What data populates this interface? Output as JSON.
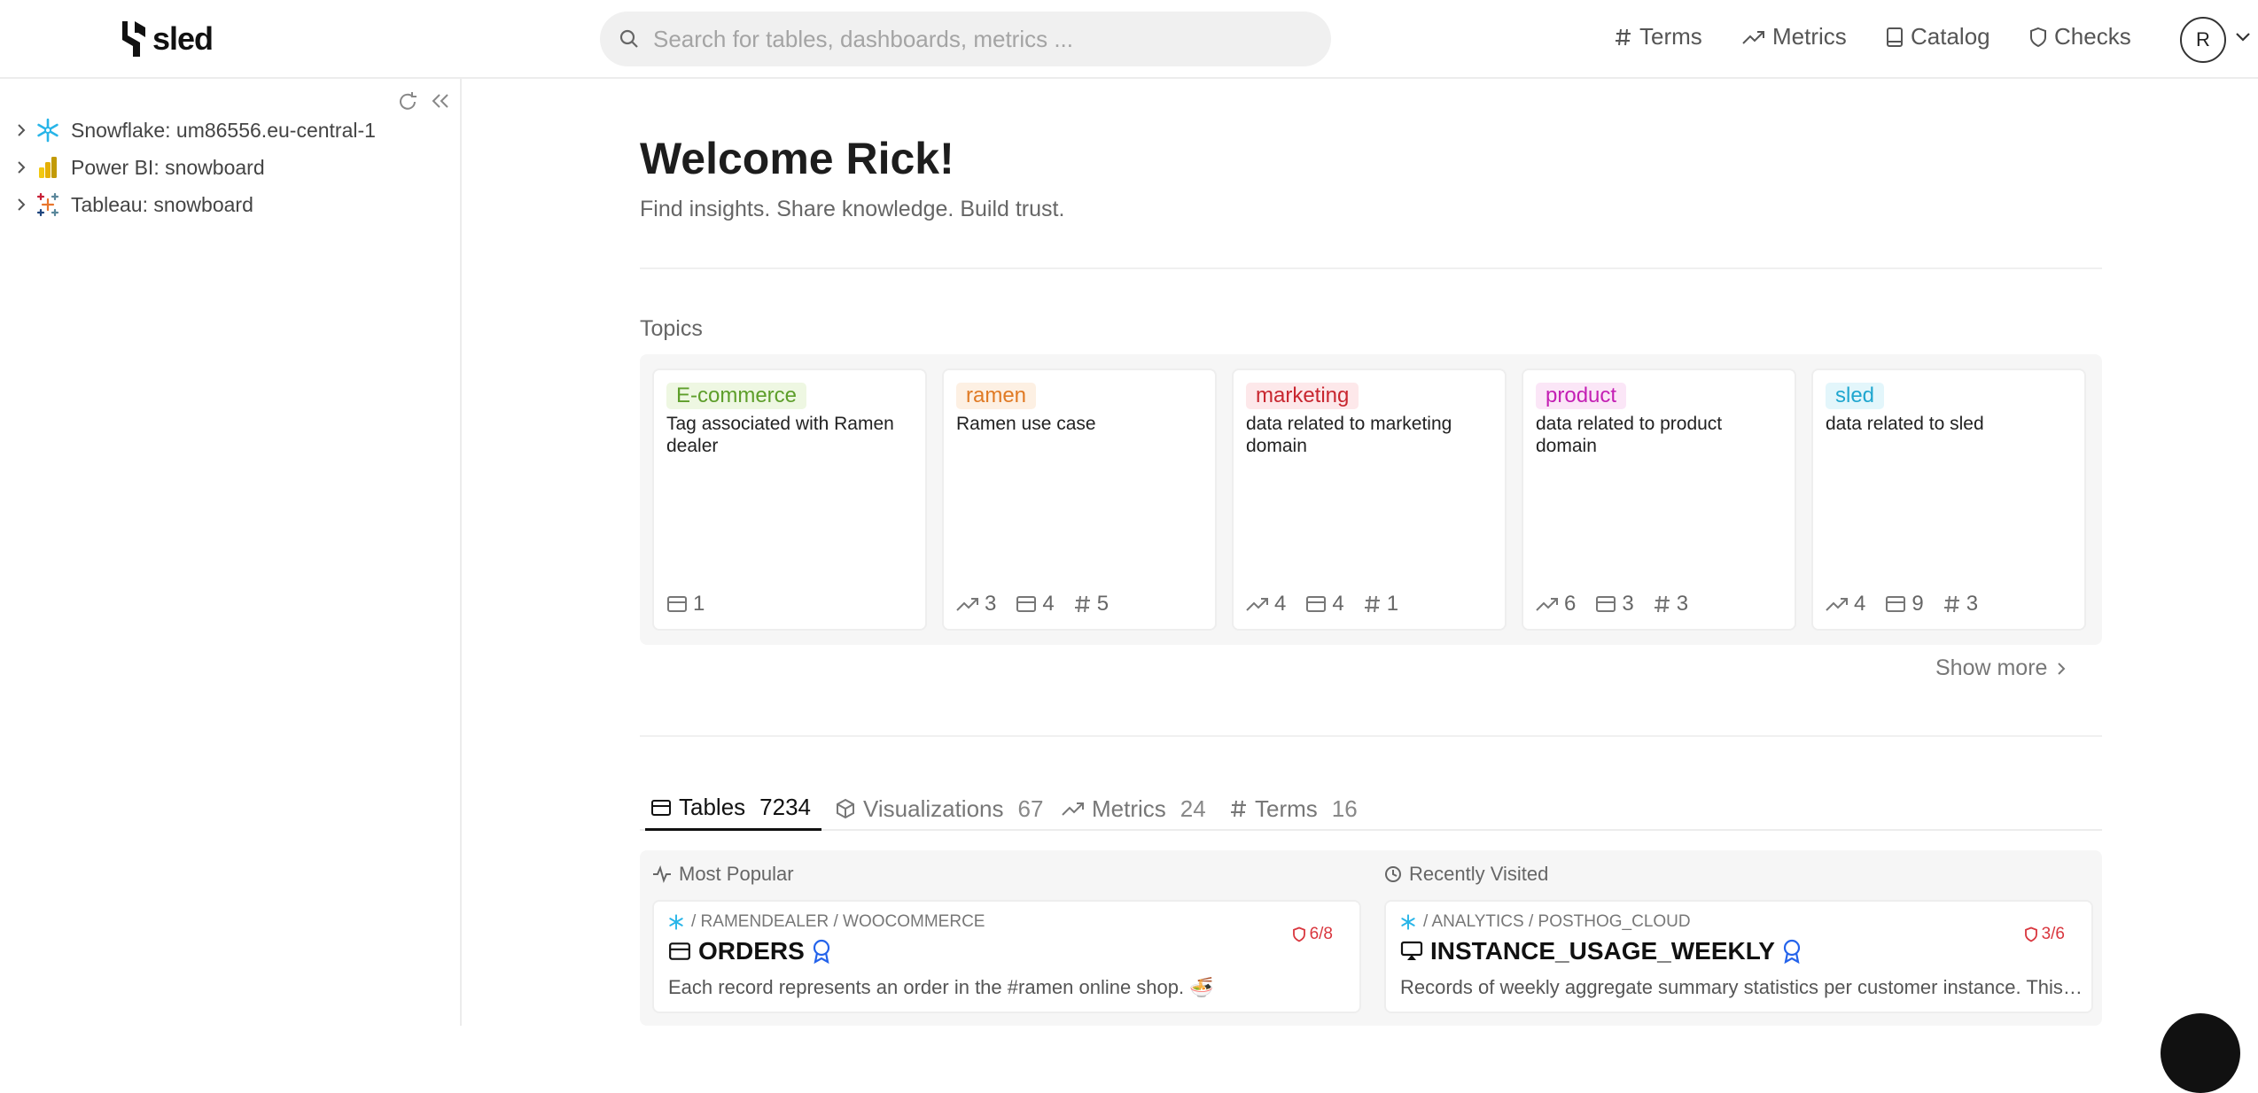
{
  "header": {
    "logo_text": "sled",
    "search_placeholder": "Search for tables, dashboards, metrics ...",
    "nav": [
      {
        "label": "Terms",
        "icon": "hash-icon"
      },
      {
        "label": "Metrics",
        "icon": "trend-icon"
      },
      {
        "label": "Catalog",
        "icon": "book-icon"
      },
      {
        "label": "Checks",
        "icon": "shield-icon"
      }
    ],
    "avatar_initial": "R"
  },
  "sidebar": {
    "items": [
      {
        "label": "Snowflake: um86556.eu-central-1",
        "icon": "snowflake-icon"
      },
      {
        "label": "Power BI: snowboard",
        "icon": "powerbi-icon"
      },
      {
        "label": "Tableau: snowboard",
        "icon": "tableau-icon"
      }
    ]
  },
  "main": {
    "welcome": "Welcome Rick!",
    "subtitle": "Find insights. Share knowledge. Build trust.",
    "topics_title": "Topics",
    "show_more": "Show more"
  },
  "topics": [
    {
      "tag": "E-commerce",
      "desc": "Tag associated with Ramen dealer",
      "tag_bg": "#eef7e2",
      "tag_color": "#5d9e2a",
      "stats": [
        {
          "icon": "table-icon",
          "value": "1"
        }
      ]
    },
    {
      "tag": "ramen",
      "desc": "Ramen use case",
      "tag_bg": "#fdf0e3",
      "tag_color": "#e07a24",
      "stats": [
        {
          "icon": "trend-icon",
          "value": "3"
        },
        {
          "icon": "table-icon",
          "value": "4"
        },
        {
          "icon": "hash-icon",
          "value": "5"
        }
      ]
    },
    {
      "tag": "marketing",
      "desc": "data related to marketing domain",
      "tag_bg": "#fde8ea",
      "tag_color": "#c8262f",
      "stats": [
        {
          "icon": "trend-icon",
          "value": "4"
        },
        {
          "icon": "table-icon",
          "value": "4"
        },
        {
          "icon": "hash-icon",
          "value": "1"
        }
      ]
    },
    {
      "tag": "product",
      "desc": "data related to product domain",
      "tag_bg": "#fbe6f7",
      "tag_color": "#c41fb4",
      "stats": [
        {
          "icon": "trend-icon",
          "value": "6"
        },
        {
          "icon": "table-icon",
          "value": "3"
        },
        {
          "icon": "hash-icon",
          "value": "3"
        }
      ]
    },
    {
      "tag": "sled",
      "desc": "data related to sled",
      "tag_bg": "#e3f6fb",
      "tag_color": "#1fa6cf",
      "stats": [
        {
          "icon": "trend-icon",
          "value": "4"
        },
        {
          "icon": "table-icon",
          "value": "9"
        },
        {
          "icon": "hash-icon",
          "value": "3"
        }
      ]
    }
  ],
  "tabs": [
    {
      "label": "Tables",
      "count": "7234",
      "icon": "table-icon",
      "active": true
    },
    {
      "label": "Visualizations",
      "count": "67",
      "icon": "cube-icon",
      "active": false
    },
    {
      "label": "Metrics",
      "count": "24",
      "icon": "trend-icon",
      "active": false
    },
    {
      "label": "Terms",
      "count": "16",
      "icon": "hash-icon",
      "active": false
    }
  ],
  "lists": {
    "popular": {
      "title": "Most Popular",
      "item": {
        "path": "/ RAMENDEALER / WOOCOMMERCE",
        "name": "ORDERS",
        "desc": "Each record represents an order in the #ramen online shop. 🍜",
        "checks": "6/8"
      }
    },
    "recent": {
      "title": "Recently Visited",
      "item": {
        "path": "/ ANALYTICS / POSTHOG_CLOUD",
        "name": "INSTANCE_USAGE_WEEKLY",
        "desc": "Records of weekly aggregate summary statistics per customer instance. This table is used to power dashboards and reports.",
        "checks": "3/6"
      }
    }
  },
  "colors": {
    "accent": "#111111",
    "check_red": "#d9363e",
    "snowflake_blue": "#29b5e8",
    "badge_blue": "#2463eb"
  }
}
